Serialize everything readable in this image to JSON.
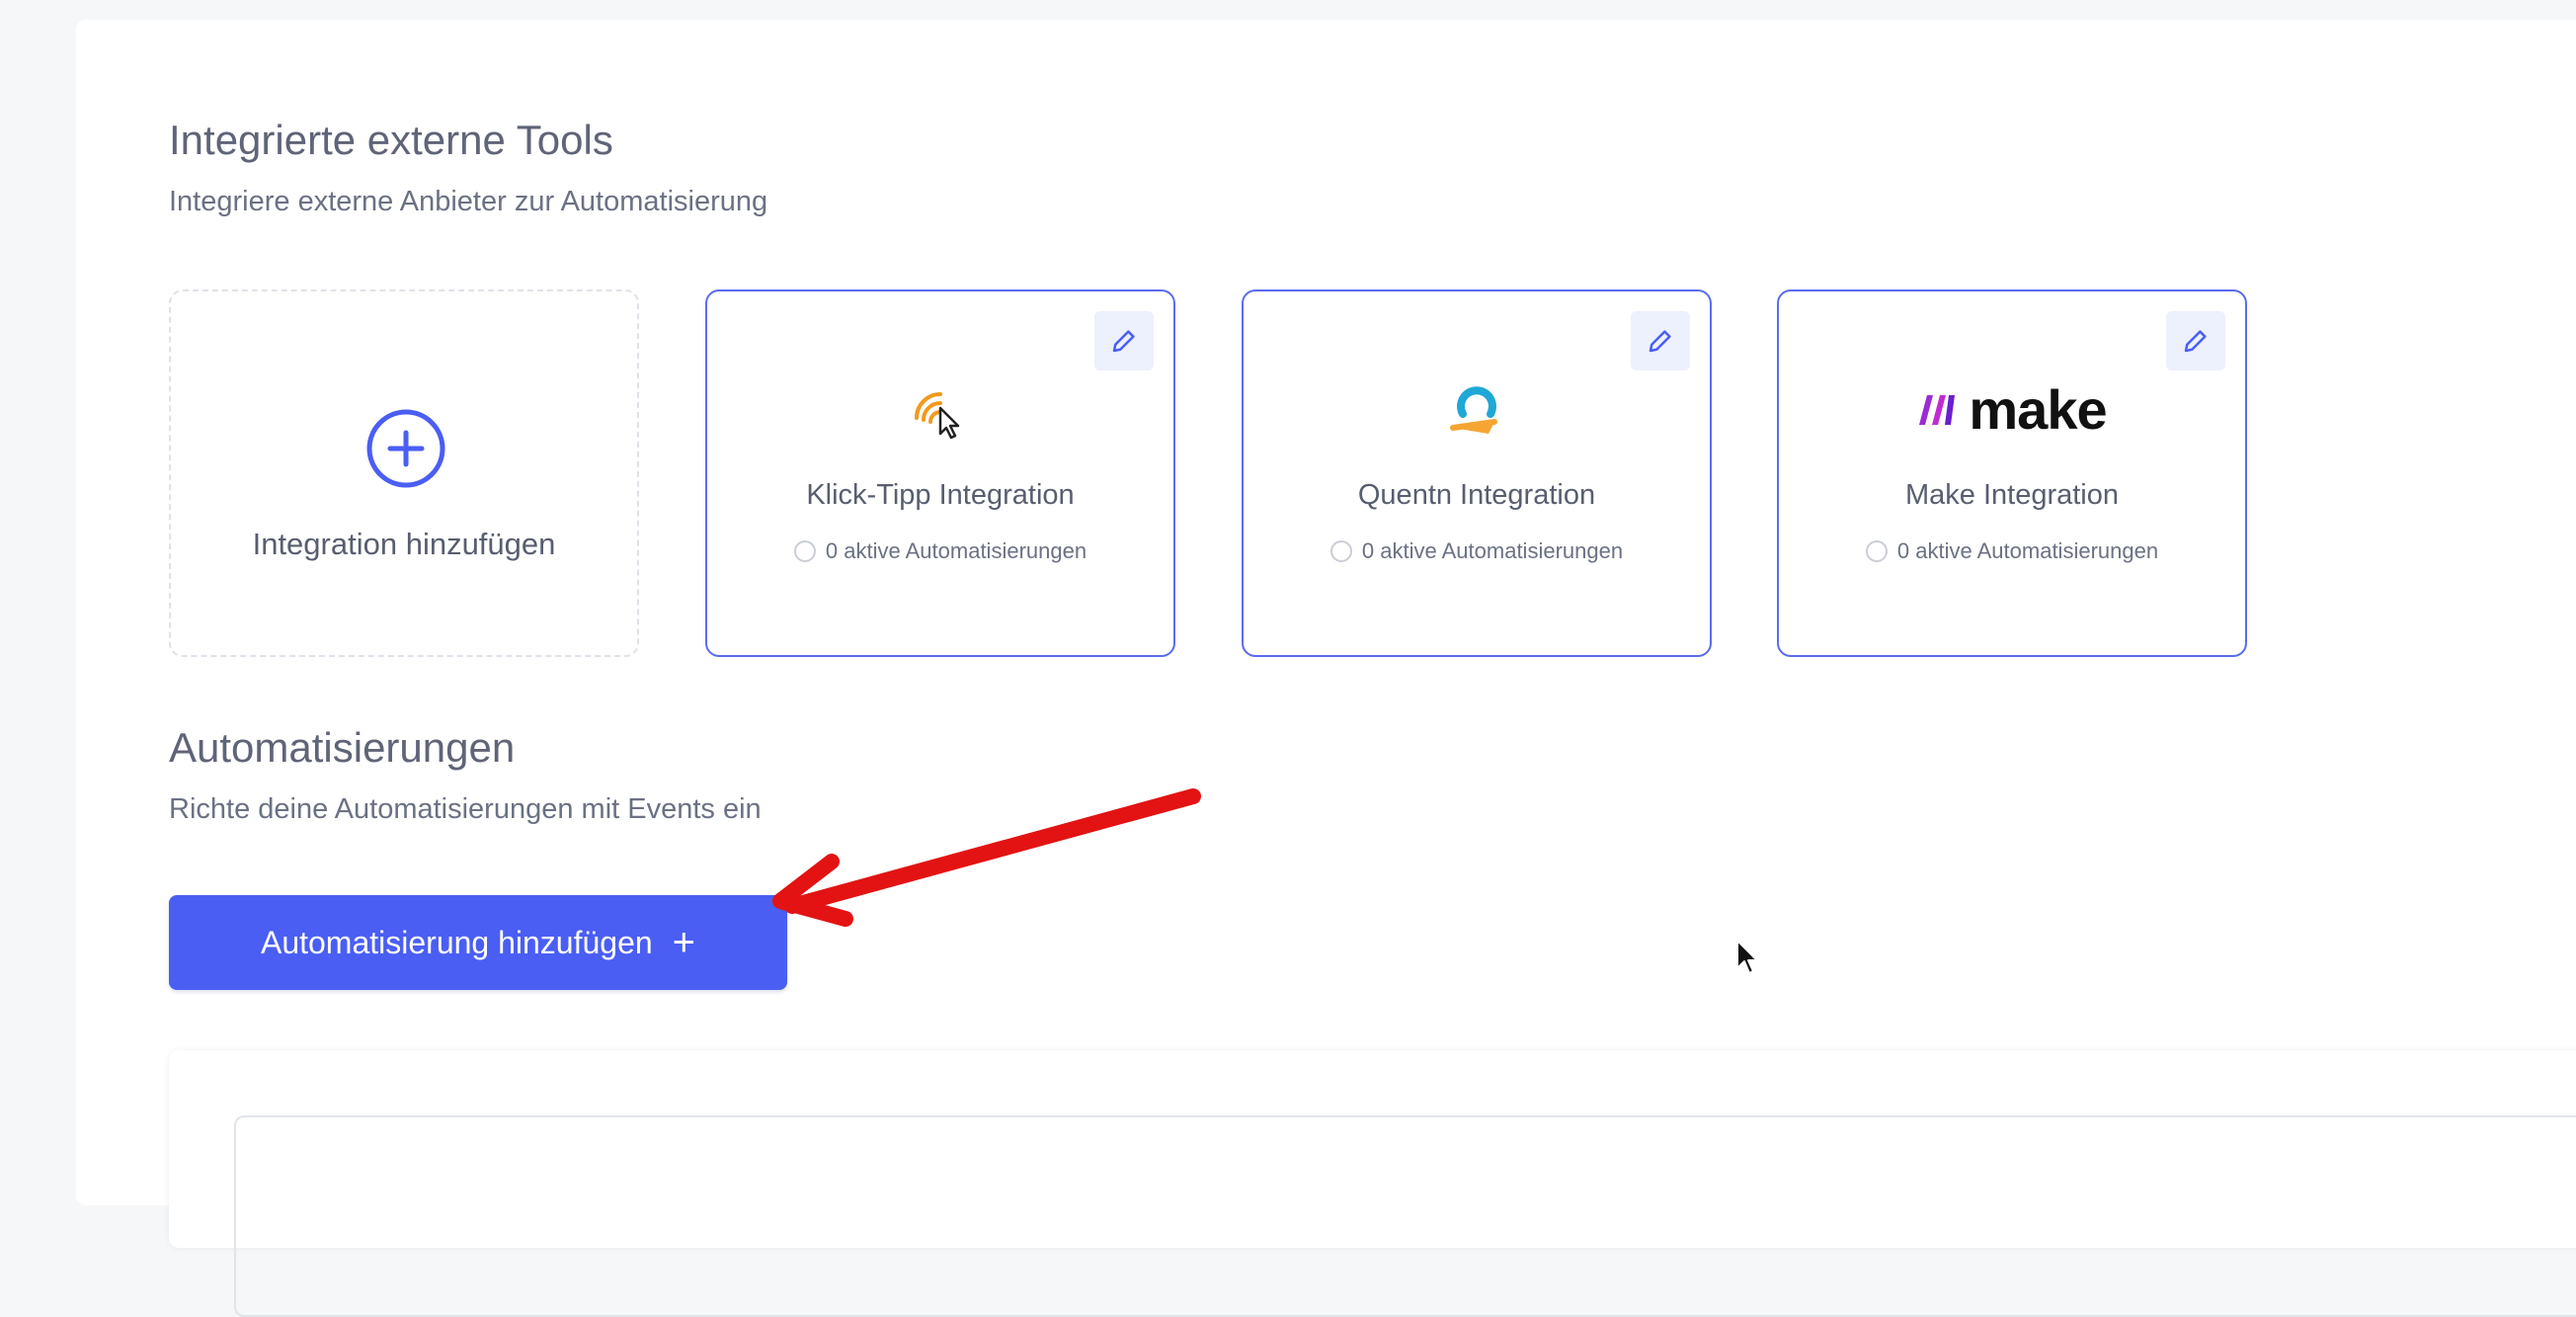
{
  "integrations_section": {
    "title": "Integrierte externe Tools",
    "subtitle": "Integriere externe Anbieter zur Automatisierung"
  },
  "add_integration": {
    "label": "Integration hinzufügen",
    "icon": "plus-circle-icon"
  },
  "integrations": [
    {
      "name": "Klick-Tipp Integration",
      "status": "0 aktive Automatisierungen",
      "logo": "klick-tipp-logo",
      "edit_icon": "pencil-icon"
    },
    {
      "name": "Quentn Integration",
      "status": "0 aktive Automatisierungen",
      "logo": "quentn-logo",
      "edit_icon": "pencil-icon"
    },
    {
      "name": "Make Integration",
      "status": "0 aktive Automatisierungen",
      "logo": "make-logo",
      "logo_text": "make",
      "edit_icon": "pencil-icon"
    }
  ],
  "automations_section": {
    "title": "Automatisierungen",
    "subtitle": "Richte deine Automatisierungen mit Events ein",
    "add_button_label": "Automatisierung hinzufügen",
    "add_button_icon": "plus-icon"
  },
  "colors": {
    "accent": "#4a5ef4",
    "card_border": "#5a6cf0",
    "annotation_arrow": "#e31313"
  }
}
